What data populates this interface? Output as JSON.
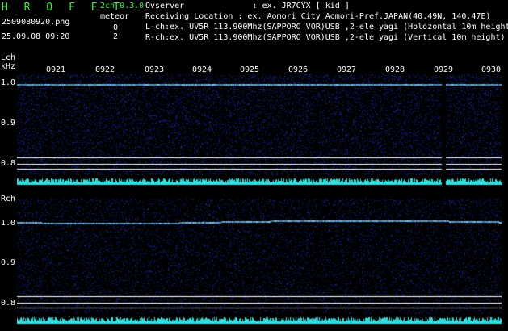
{
  "header": {
    "title": "H R O F F T",
    "filename": "2509080920.png",
    "datetime": "25.09.08 09:20",
    "channels": "2ch 0.3.0",
    "meteor_label": "meteor",
    "meteor_counts": [
      "0",
      "2"
    ],
    "observer": "Ovserver              : ex. JR7CYX [ kid ]",
    "location": "Receiving Location : ex. Aomori City Aomori-Pref.JAPAN(40.49N, 140.47E)",
    "lch_info": "L-ch:ex. UV5R 113.900Mhz(SAPPORO VOR)USB ,2-ele yagi (Holozontal 10m height",
    "rch_info": "R-ch:ex. UV5R 113.900Mhz(SAPPORO VOR)USB ,2-ele yagi (Vertical 10m height)"
  },
  "lch": {
    "label": "Lch",
    "unit": "kHz",
    "yticks": [
      "1.0",
      "0.9",
      "0.8"
    ]
  },
  "rch": {
    "label": "Rch",
    "yticks": [
      "1.0",
      "0.9",
      "0.8"
    ]
  },
  "time_ticks": [
    "0921",
    "0922",
    "0923",
    "0924",
    "0925",
    "0926",
    "0927",
    "0928",
    "0929",
    "0930"
  ],
  "colors": {
    "background": "#000000",
    "noise": "#0a1a6e",
    "carrier": "#7fd0ff",
    "baseline": "#30e0e0",
    "text_green": "#3cf03c"
  }
}
